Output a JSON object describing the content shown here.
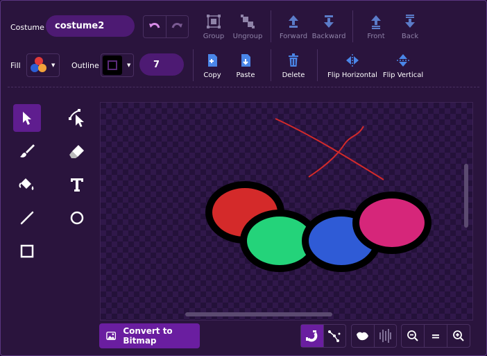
{
  "costume": {
    "label": "Costume",
    "name": "costume2"
  },
  "fill": {
    "label": "Fill"
  },
  "outline": {
    "label": "Outline",
    "width": "7"
  },
  "arrange": [
    {
      "label": "Group",
      "icon": "group-icon"
    },
    {
      "label": "Ungroup",
      "icon": "ungroup-icon"
    },
    {
      "label": "Forward",
      "icon": "forward-icon"
    },
    {
      "label": "Backward",
      "icon": "backward-icon"
    },
    {
      "label": "Front",
      "icon": "front-icon"
    },
    {
      "label": "Back",
      "icon": "back-icon"
    }
  ],
  "actions": [
    {
      "label": "Copy",
      "icon": "copy-icon"
    },
    {
      "label": "Paste",
      "icon": "paste-icon"
    },
    {
      "label": "Delete",
      "icon": "delete-icon"
    },
    {
      "label": "Flip Horizontal",
      "icon": "flip-horizontal-icon"
    },
    {
      "label": "Flip Vertical",
      "icon": "flip-vertical-icon"
    }
  ],
  "tools": [
    "select-icon",
    "reshape-icon",
    "brush-icon",
    "eraser-icon",
    "fill-icon",
    "text-icon",
    "line-icon",
    "circle-icon",
    "rectangle-icon"
  ],
  "bitmap_button": {
    "label": "Convert to Bitmap"
  },
  "zoom": {
    "reset_label": "="
  },
  "colors": {
    "accent": "#6a1ea0",
    "pill": "#4d1a73",
    "red": "#d42a2a",
    "green": "#24d37a",
    "blue": "#2f5bd6",
    "pink": "#d6267a"
  }
}
